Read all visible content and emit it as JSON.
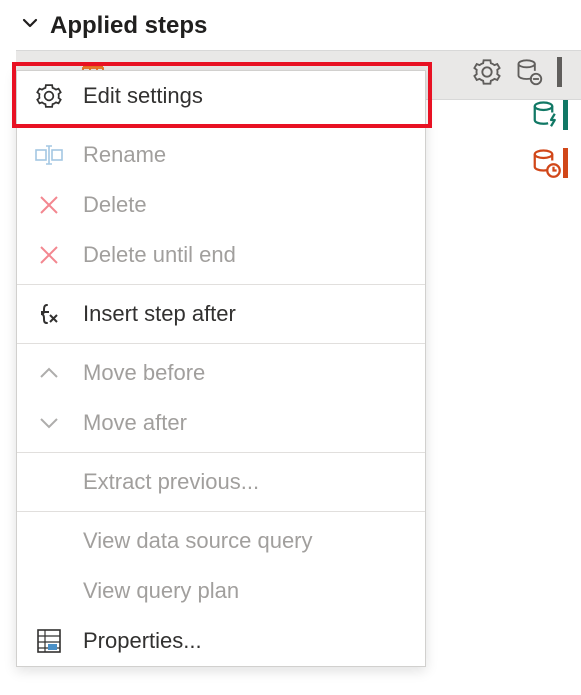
{
  "panel": {
    "title": "Applied steps"
  },
  "context_menu": {
    "items": {
      "edit_settings": "Edit settings",
      "rename": "Rename",
      "delete": "Delete",
      "delete_until_end": "Delete until end",
      "insert_step_after": "Insert step after",
      "move_before": "Move before",
      "move_after": "Move after",
      "extract_previous": "Extract previous...",
      "view_data_source_query": "View data source query",
      "view_query_plan": "View query plan",
      "properties": "Properties..."
    }
  }
}
